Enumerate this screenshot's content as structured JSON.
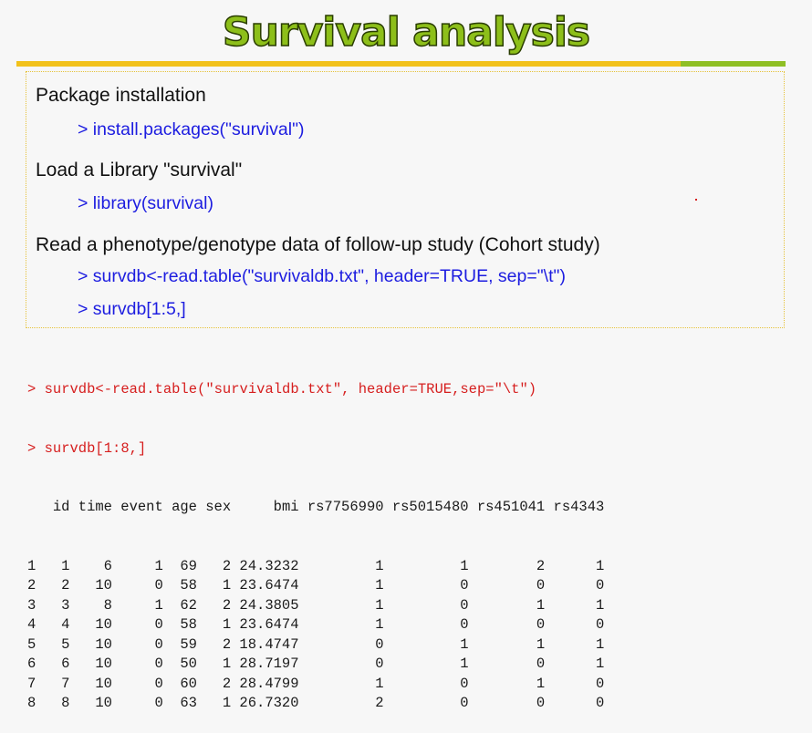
{
  "slide": {
    "title": "Survival analysis",
    "colors": {
      "title_fill": "#8dbf1a",
      "rule_yellow": "#f2c21b",
      "rule_green": "#8fbf24",
      "command_blue": "#1d1de0",
      "prompt_red": "#d61e1e"
    }
  },
  "steps": [
    {
      "heading": "Package installation",
      "commands": [
        "> install.packages(\"survival\")"
      ]
    },
    {
      "heading": "Load a Library \"survival\"",
      "commands": [
        "> library(survival)"
      ]
    },
    {
      "heading": "Read a phenotype/genotype data of follow-up study (Cohort study)",
      "commands": [
        "> survdb<-read.table(\"survivaldb.txt\", header=TRUE, sep=\"\\t\")",
        "> survdb[1:5,]"
      ]
    }
  ],
  "console": {
    "commands": [
      "> survdb<-read.table(\"survivaldb.txt\", header=TRUE,sep=\"\\t\")",
      "> survdb[1:8,]"
    ],
    "columns": [
      "id",
      "time",
      "event",
      "age",
      "sex",
      "bmi",
      "rs7756990",
      "rs5015480",
      "rs451041",
      "rs4343"
    ],
    "rows": [
      {
        "rowname": "1",
        "values": [
          "1",
          "6",
          "1",
          "69",
          "2",
          "24.3232",
          "1",
          "1",
          "2",
          "1"
        ]
      },
      {
        "rowname": "2",
        "values": [
          "2",
          "10",
          "0",
          "58",
          "1",
          "23.6474",
          "1",
          "0",
          "0",
          "0"
        ]
      },
      {
        "rowname": "3",
        "values": [
          "3",
          "8",
          "1",
          "62",
          "2",
          "24.3805",
          "1",
          "0",
          "1",
          "1"
        ]
      },
      {
        "rowname": "4",
        "values": [
          "4",
          "10",
          "0",
          "58",
          "1",
          "23.6474",
          "1",
          "0",
          "0",
          "0"
        ]
      },
      {
        "rowname": "5",
        "values": [
          "5",
          "10",
          "0",
          "59",
          "2",
          "18.4747",
          "0",
          "1",
          "1",
          "1"
        ]
      },
      {
        "rowname": "6",
        "values": [
          "6",
          "10",
          "0",
          "50",
          "1",
          "28.7197",
          "0",
          "1",
          "0",
          "1"
        ]
      },
      {
        "rowname": "7",
        "values": [
          "7",
          "10",
          "0",
          "60",
          "2",
          "28.4799",
          "1",
          "0",
          "1",
          "0"
        ]
      },
      {
        "rowname": "8",
        "values": [
          "8",
          "10",
          "0",
          "63",
          "1",
          "26.7320",
          "2",
          "0",
          "0",
          "0"
        ]
      }
    ]
  }
}
